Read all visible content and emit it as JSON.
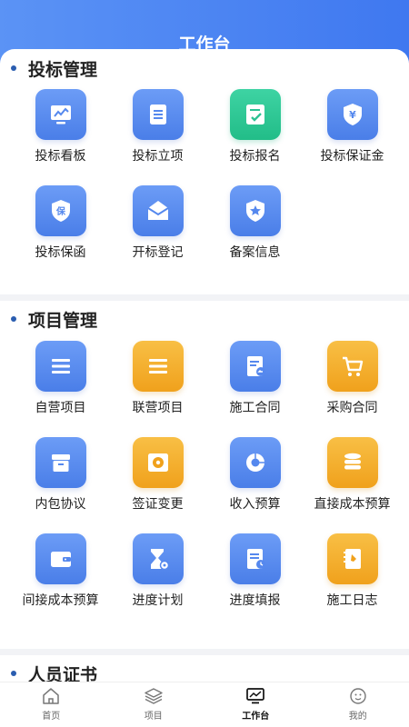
{
  "header": {
    "title": "工作台"
  },
  "sections": [
    {
      "title": "投标管理",
      "items": [
        {
          "label": "投标看板",
          "icon": "chart-board-icon",
          "color": "blue"
        },
        {
          "label": "投标立项",
          "icon": "document-list-icon",
          "color": "blue"
        },
        {
          "label": "投标报名",
          "icon": "signup-check-icon",
          "color": "green"
        },
        {
          "label": "投标保证金",
          "icon": "yuan-shield-icon",
          "color": "blue"
        },
        {
          "label": "投标保函",
          "icon": "guarantee-shield-icon",
          "color": "blue"
        },
        {
          "label": "开标登记",
          "icon": "envelope-open-icon",
          "color": "blue"
        },
        {
          "label": "备案信息",
          "icon": "star-badge-icon",
          "color": "blue"
        }
      ]
    },
    {
      "title": "项目管理",
      "items": [
        {
          "label": "自营项目",
          "icon": "list-lines-icon",
          "color": "blue"
        },
        {
          "label": "联营项目",
          "icon": "list-lines-icon",
          "color": "orange"
        },
        {
          "label": "施工合同",
          "icon": "contract-arrow-icon",
          "color": "blue"
        },
        {
          "label": "采购合同",
          "icon": "cart-icon",
          "color": "orange"
        },
        {
          "label": "内包协议",
          "icon": "box-icon",
          "color": "blue"
        },
        {
          "label": "签证变更",
          "icon": "safe-icon",
          "color": "orange"
        },
        {
          "label": "收入预算",
          "icon": "pie-chart-icon",
          "color": "blue"
        },
        {
          "label": "直接成本预算",
          "icon": "coin-stack-icon",
          "color": "orange"
        },
        {
          "label": "间接成本预算",
          "icon": "wallet-icon",
          "color": "blue"
        },
        {
          "label": "进度计划",
          "icon": "hourglass-gear-icon",
          "color": "blue"
        },
        {
          "label": "进度填报",
          "icon": "report-clock-icon",
          "color": "blue"
        },
        {
          "label": "施工日志",
          "icon": "log-book-icon",
          "color": "orange"
        }
      ]
    },
    {
      "title": "人员证书",
      "items": []
    }
  ],
  "tabbar": [
    {
      "label": "首页",
      "icon": "home-icon",
      "active": false
    },
    {
      "label": "项目",
      "icon": "layers-icon",
      "active": false
    },
    {
      "label": "工作台",
      "icon": "monitor-chart-icon",
      "active": true
    },
    {
      "label": "我的",
      "icon": "smile-face-icon",
      "active": false
    }
  ],
  "colors": {
    "primary": "#4a7ee8",
    "orange": "#f0a11c",
    "green": "#22bd88",
    "dot": "#2a5db0"
  }
}
